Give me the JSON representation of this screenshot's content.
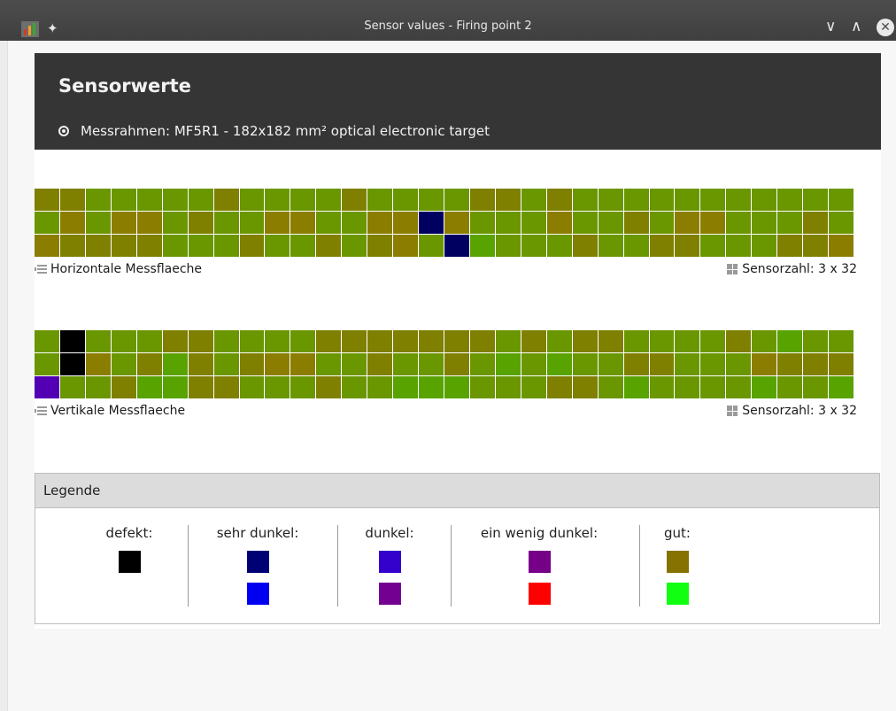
{
  "window": {
    "title": "Sensor values - Firing point 2",
    "app_icon": "chart-app-icon",
    "pin_icon": "pin-icon",
    "min_glyph": "∨",
    "max_glyph": "∧",
    "close_glyph": "✕"
  },
  "header": {
    "title": "Sensorwerte",
    "frame_label": "Messrahmen: MF5R1 - 182x182 mm² optical electronic target"
  },
  "horizontal": {
    "label": "Horizontale Messflaeche",
    "count": "Sensorzahl: 3 x 32",
    "rows": [
      "oogggggoggggoggggoogoggggggggggg",
      "gOgOOgoggOOggOOnOgggOggogOOgggog",
      "OoooogggoggogoOgnGgggoggoogggooO"
    ]
  },
  "vertical": {
    "label": "Vertikale Messflaeche",
    "count": "Sensorzahl: 3 x 32",
    "rows": [
      "gkgggooggggooooooogogooggggogGgg",
      "gkOgoGogoOOggoggogGgGggoogggOooo",
      "pggoGGoogggoggGGGgggoogGggggGggG"
    ]
  },
  "legend": {
    "title": "Legende",
    "columns": [
      {
        "label": "defekt:",
        "colors": [
          "#000000"
        ]
      },
      {
        "label": "sehr dunkel:",
        "colors": [
          "#000075",
          "#0000f0"
        ]
      },
      {
        "label": "dunkel:",
        "colors": [
          "#3300cc",
          "#730090"
        ]
      },
      {
        "label": "ein wenig dunkel:",
        "colors": [
          "#760088",
          "#ff0000"
        ]
      },
      {
        "label": "gut:",
        "colors": [
          "#867200",
          "#11ff11"
        ]
      }
    ]
  }
}
